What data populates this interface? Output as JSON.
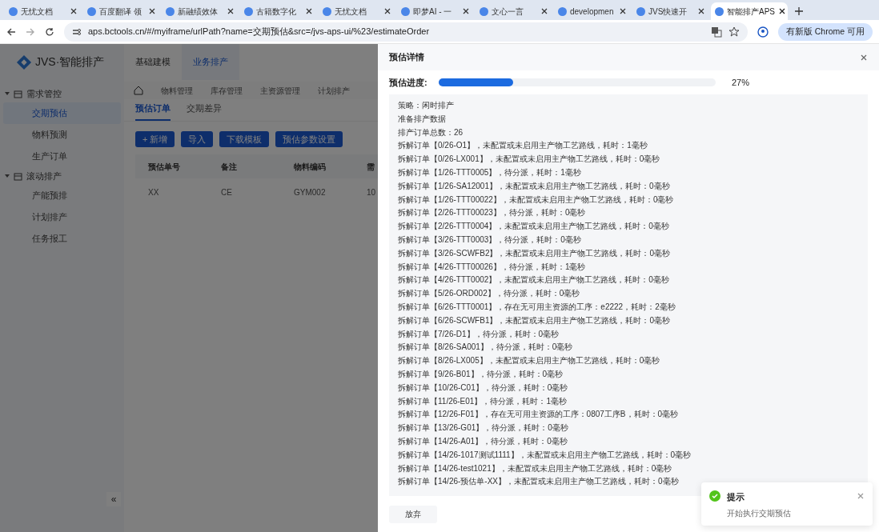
{
  "browser": {
    "tabs": [
      {
        "title": "无忧文档",
        "selected": false
      },
      {
        "title": "百度翻译 领",
        "selected": false
      },
      {
        "title": "新融绩效体",
        "selected": false
      },
      {
        "title": "古籍数字化",
        "selected": false
      },
      {
        "title": "无忧文档",
        "selected": false
      },
      {
        "title": "即梦AI - 一",
        "selected": false
      },
      {
        "title": "文心一言",
        "selected": false
      },
      {
        "title": "developmen",
        "selected": false
      },
      {
        "title": "JVS快速开",
        "selected": false
      },
      {
        "title": "智能排产APS",
        "selected": true
      }
    ],
    "url": "aps.bctools.cn/#/myiframe/urlPath?name=交期预估&src=/jvs-aps-ui/%23/estimateOrder",
    "update_button": "有新版 Chrome 可用"
  },
  "app": {
    "logo": "JVS·智能排产",
    "top_nav": [
      {
        "label": "基础建模",
        "selected": false
      },
      {
        "label": "业务排产",
        "selected": true
      }
    ],
    "sidebar": [
      {
        "label": "需求管控",
        "expanded": true,
        "children": [
          {
            "label": "交期预估",
            "selected": true
          },
          {
            "label": "物料预测",
            "selected": false
          },
          {
            "label": "生产订单",
            "selected": false
          }
        ]
      },
      {
        "label": "滚动排产",
        "expanded": true,
        "children": [
          {
            "label": "产能预排",
            "selected": false
          },
          {
            "label": "计划排产",
            "selected": false
          },
          {
            "label": "任务报工",
            "selected": false
          }
        ]
      }
    ],
    "collapse_button": "«",
    "module_tabs": [
      "物料管理",
      "库存管理",
      "主资源管理",
      "计划排产"
    ],
    "sub_tabs": [
      {
        "label": "预估订单",
        "selected": true
      },
      {
        "label": "交期差异",
        "selected": false
      }
    ],
    "buttons": [
      "+ 新增",
      "导入",
      "下载模板",
      "预估参数设置"
    ],
    "table": {
      "columns": [
        "预估单号",
        "备注",
        "物料编码",
        "需"
      ],
      "rows": [
        [
          "XX",
          "CE",
          "GYM002",
          "10"
        ]
      ]
    }
  },
  "drawer": {
    "title": "预估详情",
    "progress": {
      "label": "预估进度:",
      "level": 0.27,
      "reading": "27%"
    },
    "log": [
      "策略：闲时排产",
      "准备排产数据",
      "排产订单总数：26",
      "拆解订单【0/26-O1】，未配置或未启用主产物工艺路线，耗时：1毫秒",
      "拆解订单【0/26-LX001】，未配置或未启用主产物工艺路线，耗时：0毫秒",
      "拆解订单【1/26-TTT0005】，待分派，耗时：1毫秒",
      "拆解订单【1/26-SA12001】，未配置或未启用主产物工艺路线，耗时：0毫秒",
      "拆解订单【1/26-TTT00022】，未配置或未启用主产物工艺路线，耗时：0毫秒",
      "拆解订单【2/26-TTT00023】，待分派，耗时：0毫秒",
      "拆解订单【2/26-TTT0004】，未配置或未启用主产物工艺路线，耗时：0毫秒",
      "拆解订单【3/26-TTT0003】，待分派，耗时：0毫秒",
      "拆解订单【3/26-SCWFB2】，未配置或未启用主产物工艺路线，耗时：0毫秒",
      "拆解订单【4/26-TTT00026】，待分派，耗时：1毫秒",
      "拆解订单【4/26-TTT0002】，未配置或未启用主产物工艺路线，耗时：0毫秒",
      "拆解订单【5/26-ORD002】，待分派，耗时：0毫秒",
      "拆解订单【6/26-TTT0001】，存在无可用主资源的工序：e2222，耗时：2毫秒",
      "拆解订单【6/26-SCWFB1】，未配置或未启用主产物工艺路线，耗时：0毫秒",
      "拆解订单【7/26-D1】，待分派，耗时：0毫秒",
      "拆解订单【8/26-SA001】，待分派，耗时：0毫秒",
      "拆解订单【8/26-LX005】，未配置或未启用主产物工艺路线，耗时：0毫秒",
      "拆解订单【9/26-B01】，待分派，耗时：0毫秒",
      "拆解订单【10/26-C01】，待分派，耗时：0毫秒",
      "拆解订单【11/26-E01】，待分派，耗时：1毫秒",
      "拆解订单【12/26-F01】，存在无可用主资源的工序：0807工序B，耗时：0毫秒",
      "拆解订单【13/26-G01】，待分派，耗时：0毫秒",
      "拆解订单【14/26-A01】，待分派，耗时：0毫秒",
      "拆解订单【14/26-1017测试1111】，未配置或未启用主产物工艺路线，耗时：0毫秒",
      "拆解订单【14/26-test1021】，未配置或未启用主产物工艺路线，耗时：0毫秒",
      "拆解订单【14/26-预估单-XX】，未配置或未启用主产物工艺路线，耗时：0毫秒"
    ],
    "footer_button": "放弃"
  },
  "toast": {
    "kind": "success",
    "title": "提示",
    "message": "开始执行交期预估"
  }
}
